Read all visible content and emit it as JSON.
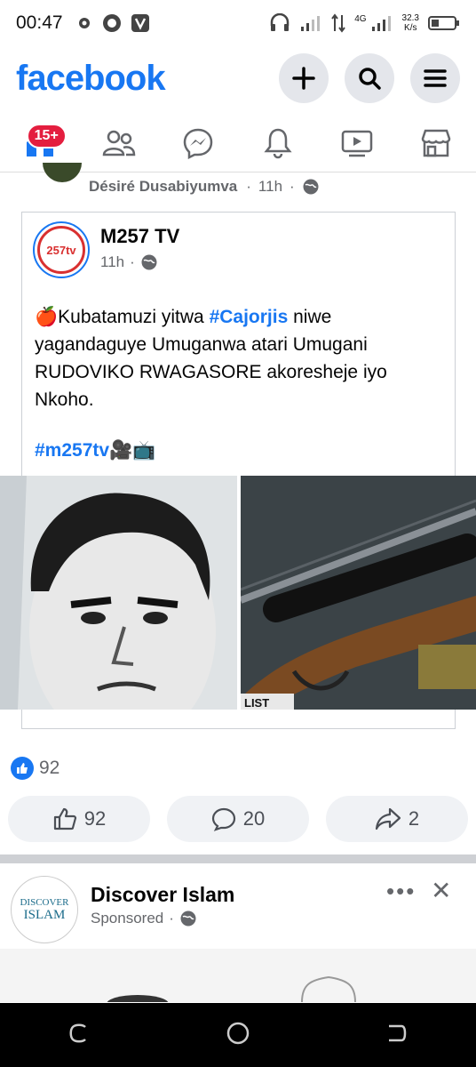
{
  "status_bar": {
    "time": "00:47",
    "speed_value": "32.3",
    "speed_unit": "K/s",
    "network": "4G"
  },
  "header": {
    "logo": "facebook",
    "buttons": [
      "plus-icon",
      "search-icon",
      "menu-icon"
    ]
  },
  "nav": {
    "items": [
      "home-icon",
      "friends-icon",
      "messenger-icon",
      "notifications-icon",
      "watch-icon",
      "marketplace-icon"
    ],
    "home_badge": "15+"
  },
  "prev_post": {
    "author": "Désiré Dusabiyumva",
    "time": "11h",
    "dot": "·"
  },
  "shared_post": {
    "page_name": "M257 TV",
    "avatar_text": "257tv",
    "time": "11h",
    "dot": "·",
    "text_prefix": "Kubatamuzi yitwa ",
    "text_hashtag": "#Cajorjis",
    "text_suffix": " niwe yagandaguye Umuganwa atari Umugani RUDOVIKO RWAGASORE akoresheje iyo Nkoho.",
    "tag": "#m257tv",
    "tag_emoji": "🎥📺",
    "text_emoji": "🍎",
    "photo_right_caption": "LIST"
  },
  "reactions": {
    "count": "92"
  },
  "actions": [
    {
      "icon": "thumbs-up-icon",
      "label": "92"
    },
    {
      "icon": "comment-icon",
      "label": "20"
    },
    {
      "icon": "share-icon",
      "label": "2"
    }
  ],
  "ad": {
    "name": "Discover Islam",
    "sponsored": "Sponsored",
    "dot": "·",
    "avatar_line1": "DISCOVER",
    "avatar_line2": "ISLAM",
    "more": "•••",
    "close": "✕"
  },
  "colors": {
    "brand": "#1877f2",
    "badge": "#e41e3f",
    "muted": "#65676b",
    "button_bg": "#f0f2f5"
  }
}
